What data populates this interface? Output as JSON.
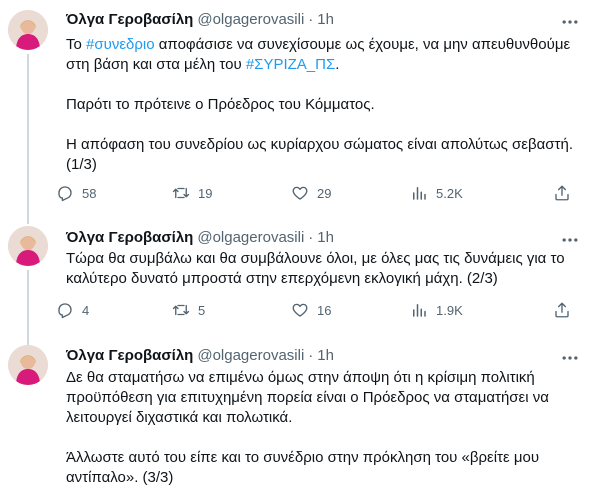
{
  "tweets": [
    {
      "author": {
        "name": "Όλγα Γεροβασίλη",
        "handle": "@olgagerovasili",
        "time": "1h"
      },
      "lines": [
        [
          {
            "t": "Το "
          },
          {
            "t": "#συνεδριο",
            "tag": true
          },
          {
            "t": " αποφάσισε να συνεχίσουμε ως έχουμε, να μην απευθυνθούμε"
          }
        ],
        [
          {
            "t": "στη βάση και στα μέλη του "
          },
          {
            "t": "#ΣΥΡΙΖΑ_ΠΣ",
            "tag": true
          },
          {
            "t": "."
          }
        ],
        [],
        [
          {
            "t": "Παρότι το πρότεινε ο Πρόεδρος του Κόμματος."
          }
        ],
        [],
        [
          {
            "t": "Η απόφαση του συνεδρίου ως κυρίαρχου σώματος είναι απολύτως σεβαστή."
          }
        ],
        [
          {
            "t": "(1/3)"
          }
        ]
      ],
      "stats": {
        "replies": "58",
        "retweets": "19",
        "likes": "29",
        "views": "5.2K"
      }
    },
    {
      "author": {
        "name": "Όλγα Γεροβασίλη",
        "handle": "@olgagerovasili",
        "time": "1h"
      },
      "lines": [
        [
          {
            "t": "Τώρα θα συμβάλω και θα συμβάλουνε όλοι, με όλες μας τις δυνάμεις για το"
          }
        ],
        [
          {
            "t": "καλύτερο δυνατό μπροστά στην επερχόμενη εκλογική μάχη. (2/3)"
          }
        ]
      ],
      "stats": {
        "replies": "4",
        "retweets": "5",
        "likes": "16",
        "views": "1.9K"
      }
    },
    {
      "author": {
        "name": "Όλγα Γεροβασίλη",
        "handle": "@olgagerovasili",
        "time": "1h"
      },
      "lines": [
        [
          {
            "t": "Δε θα σταματήσω να επιμένω όμως στην άποψη ότι η κρίσιμη πολιτική"
          }
        ],
        [
          {
            "t": "προϋπόθεση για επιτυχημένη πορεία είναι ο Πρόεδρος να σταματήσει να"
          }
        ],
        [
          {
            "t": "λειτουργεί διχαστικά και πολωτικά."
          }
        ],
        [],
        [
          {
            "t": "Άλλωστε αυτό του είπε και το συνέδριο στην πρόκληση του «βρείτε μου"
          }
        ],
        [
          {
            "t": "αντίπαλο». (3/3)"
          }
        ]
      ]
    }
  ]
}
